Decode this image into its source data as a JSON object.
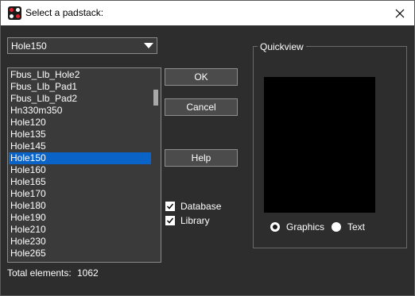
{
  "window": {
    "title": "Select a padstack:",
    "app_icon": "padstack-app-icon",
    "close_icon": "close-icon"
  },
  "combo": {
    "value": "Hole150",
    "icon": "chevron-down-icon"
  },
  "list": {
    "items": [
      "Fbus_Llb_Hole2",
      "Fbus_Llb_Pad1",
      "Fbus_Llb_Pad2",
      "Hn330m350",
      "Hole120",
      "Hole135",
      "Hole145",
      "Hole150",
      "Hole160",
      "Hole165",
      "Hole170",
      "Hole180",
      "Hole190",
      "Hole210",
      "Hole230",
      "Hole265"
    ],
    "selected": "Hole150"
  },
  "buttons": {
    "ok": "OK",
    "cancel": "Cancel",
    "help": "Help"
  },
  "checks": {
    "database": {
      "label": "Database",
      "checked": true
    },
    "library": {
      "label": "Library",
      "checked": true
    }
  },
  "footer": {
    "total_label": "Total elements:",
    "total_value": "1062"
  },
  "quickview": {
    "title": "Quickview",
    "graphics_label": "Graphics",
    "text_label": "Text",
    "selected_mode": "Graphics"
  },
  "colors": {
    "background": "#2d2d2d",
    "selection": "#0a64c8",
    "preview": "#000000"
  }
}
